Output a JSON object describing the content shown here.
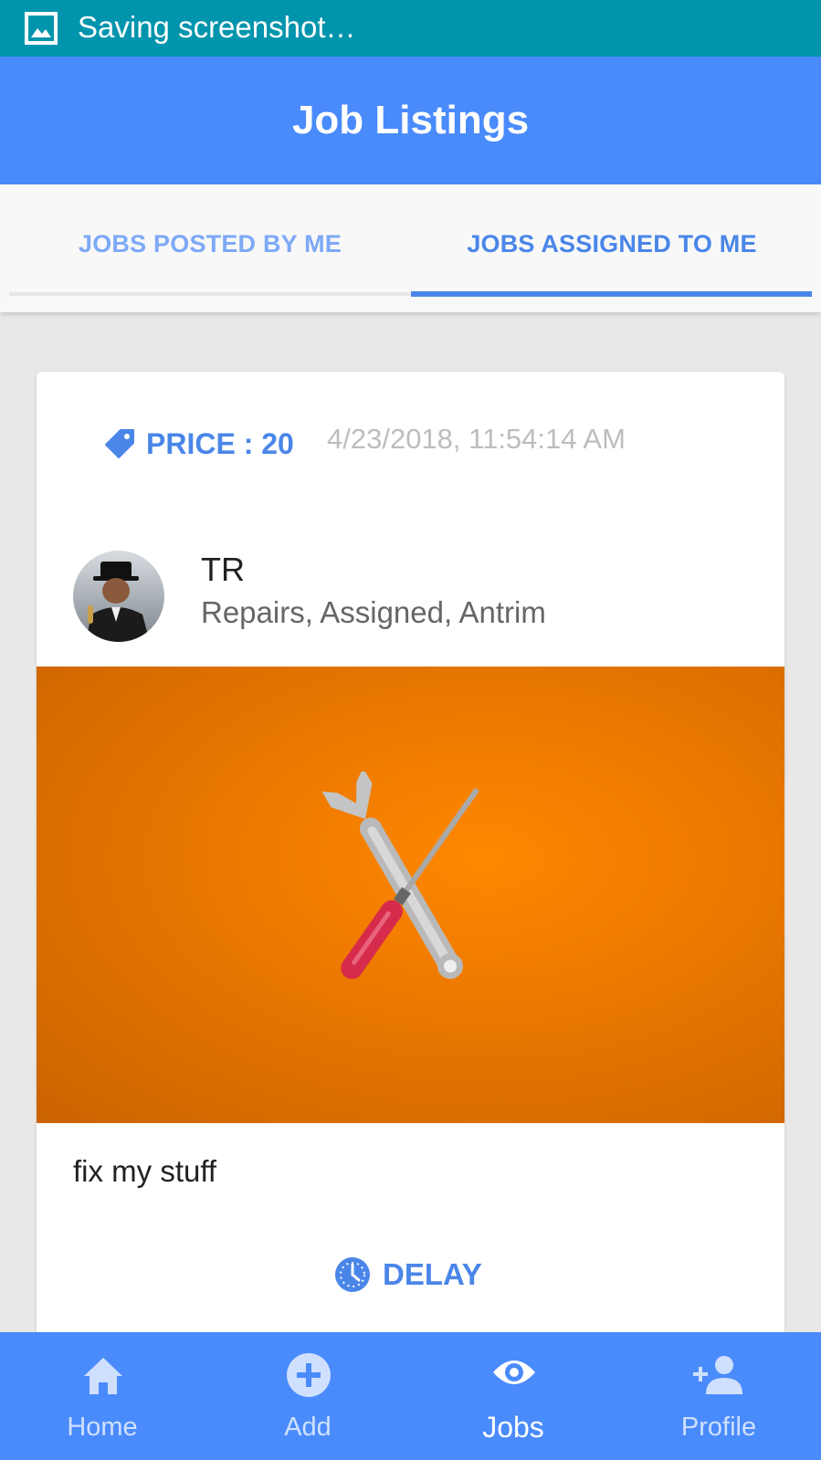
{
  "status_bar": {
    "text": "Saving screenshot…",
    "icon": "image-icon"
  },
  "app_bar": {
    "title": "Job Listings"
  },
  "tabs": [
    {
      "label": "JOBS POSTED BY ME",
      "active": false
    },
    {
      "label": "JOBS ASSIGNED TO ME",
      "active": true
    }
  ],
  "job": {
    "price_label": "PRICE : 20",
    "date": "4/23/2018, 11:54:14 AM",
    "poster_name": "TR",
    "meta": "Repairs, Assigned, Antrim",
    "description": "fix my stuff",
    "action_label": "DELAY",
    "image": "wrench-and-screwdriver"
  },
  "bottom_nav": [
    {
      "label": "Home",
      "icon": "home-icon",
      "active": false
    },
    {
      "label": "Add",
      "icon": "add-circle-icon",
      "active": false
    },
    {
      "label": "Jobs",
      "icon": "eye-icon",
      "active": true
    },
    {
      "label": "Profile",
      "icon": "person-add-icon",
      "active": false
    }
  ],
  "colors": {
    "status_bar": "#0095ad",
    "primary": "#4a8bfc",
    "accent": "#4a86e8",
    "hero_orange": "#ff8800"
  }
}
